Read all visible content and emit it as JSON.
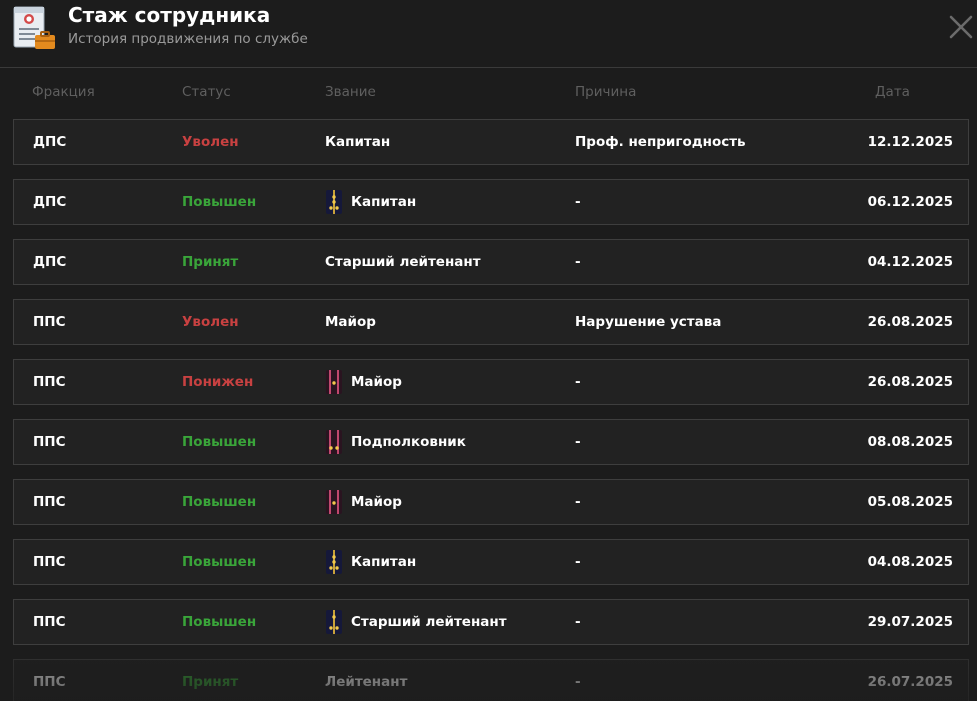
{
  "header": {
    "title": "Стаж сотрудника",
    "subtitle": "История продвижения по службе",
    "icon": "personnel-file-icon",
    "close_icon": "close-icon"
  },
  "columns": {
    "faction": "Фракция",
    "status": "Статус",
    "rank": "Звание",
    "reason": "Причина",
    "date": "Дата"
  },
  "colors": {
    "status_fired": "#c84141",
    "status_promoted": "#3aa53a",
    "status_hired": "#3aa53a",
    "status_demoted": "#c84141"
  },
  "rows": [
    {
      "faction": "ДПС",
      "status": "Уволен",
      "status_color": "red",
      "rank": "Капитан",
      "rank_icon": "",
      "reason": "Проф. непригодность",
      "date": "12.12.2025"
    },
    {
      "faction": "ДПС",
      "status": "Повышен",
      "status_color": "green",
      "rank": "Капитан",
      "rank_icon": "dps-captain-shoulder-strap-icon",
      "reason": "-",
      "date": "06.12.2025"
    },
    {
      "faction": "ДПС",
      "status": "Принят",
      "status_color": "green",
      "rank": "Старший лейтенант",
      "rank_icon": "",
      "reason": "-",
      "date": "04.12.2025"
    },
    {
      "faction": "ППС",
      "status": "Уволен",
      "status_color": "red",
      "rank": "Майор",
      "rank_icon": "",
      "reason": "Нарушение устава",
      "date": "26.08.2025"
    },
    {
      "faction": "ППС",
      "status": "Понижен",
      "status_color": "red",
      "rank": "Майор",
      "rank_icon": "major-shoulder-strap-icon",
      "reason": "-",
      "date": "26.08.2025"
    },
    {
      "faction": "ППС",
      "status": "Повышен",
      "status_color": "green",
      "rank": "Подполковник",
      "rank_icon": "lieutenant-colonel-shoulder-strap-icon",
      "reason": "-",
      "date": "08.08.2025"
    },
    {
      "faction": "ППС",
      "status": "Повышен",
      "status_color": "green",
      "rank": "Майор",
      "rank_icon": "major-shoulder-strap-icon",
      "reason": "-",
      "date": "05.08.2025"
    },
    {
      "faction": "ППС",
      "status": "Повышен",
      "status_color": "green",
      "rank": "Капитан",
      "rank_icon": "captain-shoulder-strap-icon",
      "reason": "-",
      "date": "04.08.2025"
    },
    {
      "faction": "ППС",
      "status": "Повышен",
      "status_color": "green",
      "rank": "Старший лейтенант",
      "rank_icon": "senior-lieutenant-shoulder-strap-icon",
      "reason": "-",
      "date": "29.07.2025"
    },
    {
      "faction": "ППС",
      "status": "Принят",
      "status_color": "green",
      "rank": "Лейтенант",
      "rank_icon": "",
      "reason": "-",
      "date": "26.07.2025"
    }
  ]
}
